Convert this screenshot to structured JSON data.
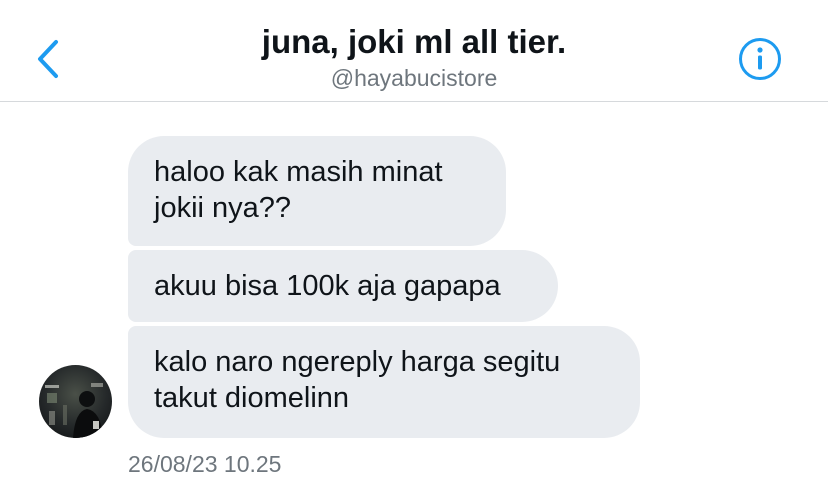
{
  "header": {
    "title": "juna, joki ml all tier.",
    "handle": "@hayabucistore",
    "back_icon": "chevron-left-icon",
    "info_icon": "info-circle-icon"
  },
  "messages": [
    {
      "text": "haloo kak masih minat\njokii nya??"
    },
    {
      "text": "akuu bisa 100k aja gapapa"
    },
    {
      "text": "kalo naro ngereply harga segitu\ntakut diomelinn"
    }
  ],
  "timestamp": "26/08/23 10.25",
  "colors": {
    "accent": "#1d9bf0",
    "bubble_bg": "#e9ecf0",
    "text_primary": "#0f1419",
    "text_secondary": "#6e767d",
    "divider": "#d6d9dc"
  }
}
